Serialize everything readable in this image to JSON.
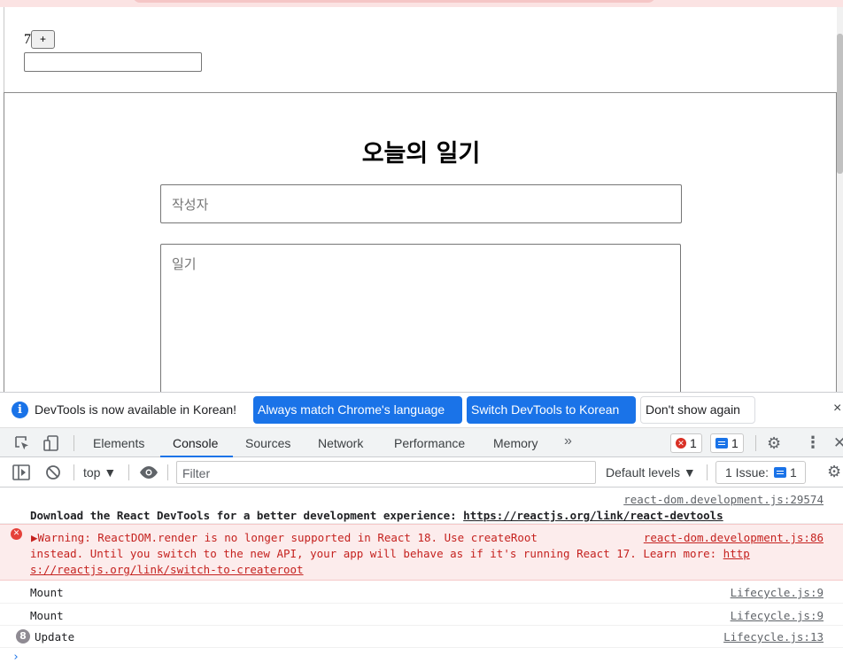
{
  "page": {
    "counter_value": "7",
    "plus_label": "+",
    "diary": {
      "title": "오늘의 일기",
      "author_placeholder": "작성자",
      "content_placeholder": "일기"
    }
  },
  "devtools": {
    "infobar": {
      "message": "DevTools is now available in Korean!",
      "always_match": "Always match Chrome's language",
      "switch_korean": "Switch DevTools to Korean",
      "dont_show": "Don't show again",
      "close": "×"
    },
    "tabs": [
      "Elements",
      "Console",
      "Sources",
      "Network",
      "Performance",
      "Memory"
    ],
    "active_tab": "Console",
    "more_tabs": "»",
    "error_count": "1",
    "message_count": "1",
    "filterbar": {
      "context": "top ▼",
      "filter_placeholder": "Filter",
      "levels": "Default levels ▼",
      "issues_label": "1 Issue:",
      "issues_count": "1"
    },
    "console": {
      "log1": {
        "source": "react-dom.development.js:29574",
        "text": "Download the React DevTools for a better development experience: ",
        "link": "https://reactjs.org/link/react-devtools"
      },
      "warning": {
        "line1": "▶Warning: ReactDOM.render is no longer supported in React 18. Use createRoot",
        "source": "react-dom.development.js:86",
        "line2_text": "instead. Until you switch to the new API, your app will behave as if it's running React 17. Learn more: ",
        "line2_link": "http",
        "line3_link": "s://reactjs.org/link/switch-to-createroot"
      },
      "rows": [
        {
          "text": "Mount",
          "source": "Lifecycle.js:9"
        },
        {
          "text": "Mount",
          "source": "Lifecycle.js:9"
        },
        {
          "text": "Update",
          "source": "Lifecycle.js:13",
          "count": "8"
        }
      ],
      "prompt": "›"
    }
  },
  "colors": {
    "accent": "#1a73e8",
    "error": "#d93025",
    "warning_bg": "#fcecec"
  }
}
